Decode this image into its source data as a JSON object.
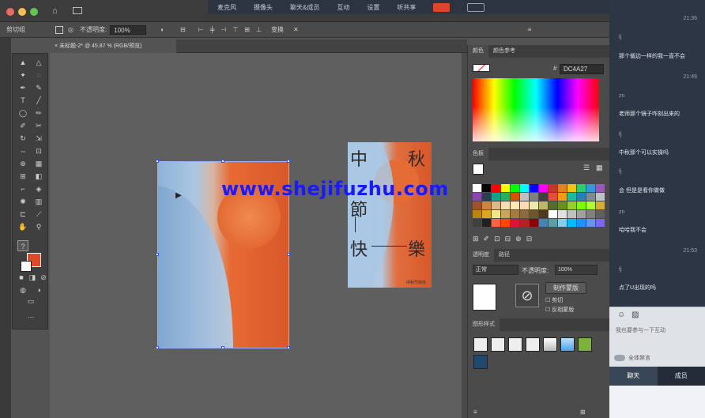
{
  "meeting_bar": {
    "items": [
      "麦克风",
      "摄像头",
      "聊天&成员",
      "互动",
      "设置",
      "听共享"
    ]
  },
  "control_bar": {
    "label": "剪切组",
    "opacity_label": "不透明度:",
    "opacity_value": "100%",
    "transform_label": "变换"
  },
  "document": {
    "tab_title": "未标题-2* @ 45.87 % (RGB/预览)"
  },
  "artboards": {
    "right_title_chars": [
      "中",
      "秋",
      "節",
      "快",
      "樂"
    ],
    "cursor_label": "",
    "small_text": "中秋节快乐"
  },
  "watermark": "www.shejifuzhu.com",
  "color_panel": {
    "tabs": [
      "颜色",
      "颜色参考"
    ],
    "hex_label": "#",
    "hex_value": "DC4A27"
  },
  "swatches_panel": {
    "tab": "色板"
  },
  "transparency_panel": {
    "tabs": [
      "透明度",
      "路径"
    ],
    "blend_mode": "正常",
    "opacity_label": "不透明度:",
    "opacity_value": "100%",
    "make_mask_label": "制作蒙版",
    "clip_label": "剪切",
    "invert_label": "反相蒙版"
  },
  "graphic_styles_panel": {
    "tab": "图形样式"
  },
  "chat": {
    "messages": [
      {
        "time": "21:36",
        "user": "fj",
        "text": "那个循边一样的我一直不会"
      },
      {
        "time": "21:49",
        "user": "zn",
        "text": "老师那个镜子咋刻出来的"
      },
      {
        "time": "",
        "user": "fj",
        "text": "中秋那个可以实操吗"
      },
      {
        "time": "",
        "user": "fj",
        "text": "会 但是是看你做做"
      },
      {
        "time": "",
        "user": "zn",
        "text": "哈哈我不会"
      },
      {
        "time": "21:53",
        "user": "fj",
        "text": "点了U出现的吗"
      }
    ],
    "input_placeholder": "我也要参与一下互动",
    "mute_all_label": "全体禁言",
    "tabs": [
      "聊天",
      "成员"
    ]
  },
  "colors": {
    "accent_orange": "#DC4A27",
    "chat_bg": "#2c3645",
    "watermark": "#1a1aff"
  },
  "swatch_colors": [
    "#ffffff",
    "#000000",
    "#ff0000",
    "#ffff00",
    "#00ff00",
    "#00ffff",
    "#0000ff",
    "#ff00ff",
    "#c0392b",
    "#e67e22",
    "#f1c40f",
    "#2ecc71",
    "#3498db",
    "#9b59b6",
    "#8e44ad",
    "#2c3e50",
    "#16a085",
    "#27ae60",
    "#d35400",
    "#c0c0c0",
    "#808080",
    "#404040",
    "#e74c3c",
    "#f39c12",
    "#1abc9c",
    "#2980b9",
    "#7f8c8d",
    "#bdc3c7",
    "#a0522d",
    "#cd853f",
    "#deb887",
    "#f5deb3",
    "#ffe4b5",
    "#ffdab9",
    "#eee8aa",
    "#bdb76b",
    "#556b2f",
    "#6b8e23",
    "#9acd32",
    "#7cfc00",
    "#adff2f",
    "#d4af37",
    "#b8860b",
    "#daa520",
    "#f0e68c",
    "#c9a75a",
    "#a57c3f",
    "#8b6b3d",
    "#6e5530",
    "#4d3b21",
    "#ffffff",
    "#e0e0e0",
    "#c0c0c0",
    "#a0a0a0",
    "#808080",
    "#606060",
    "#404040",
    "#202020",
    "#ff6347",
    "#ff4500",
    "#dc143c",
    "#b22222",
    "#8b0000",
    "#4682b4",
    "#5f9ea0",
    "#87ceeb",
    "#00bfff",
    "#1e90ff",
    "#6495ed",
    "#7b68ee"
  ]
}
